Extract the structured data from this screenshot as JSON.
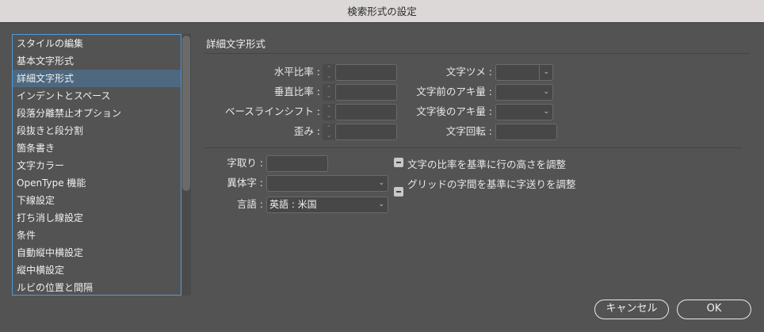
{
  "window": {
    "title": "検索形式の設定"
  },
  "sidebar": {
    "items": [
      "スタイルの編集",
      "基本文字形式",
      "詳細文字形式",
      "インデントとスペース",
      "段落分離禁止オプション",
      "段抜きと段分割",
      "箇条書き",
      "文字カラー",
      "OpenType 機能",
      "下線設定",
      "打ち消し線設定",
      "条件",
      "自動縦中横設定",
      "縦中横設定",
      "ルビの位置と間隔"
    ],
    "selected_index": 2
  },
  "panel": {
    "heading": "詳細文字形式",
    "horizontal_scale": {
      "label": "水平比率 :",
      "value": ""
    },
    "vertical_scale": {
      "label": "垂直比率 :",
      "value": ""
    },
    "baseline_shift": {
      "label": "ベースラインシフト :",
      "value": ""
    },
    "skew": {
      "label": "歪み :",
      "value": ""
    },
    "tsume": {
      "label": "文字ツメ :",
      "value": ""
    },
    "aki_before": {
      "label": "文字前のアキ量 :",
      "value": ""
    },
    "aki_after": {
      "label": "文字後のアキ量 :",
      "value": ""
    },
    "rotation": {
      "label": "文字回転 :",
      "value": ""
    },
    "mojidori": {
      "label": "字取り :",
      "value": ""
    },
    "itaiji": {
      "label": "異体字 :",
      "value": ""
    },
    "language": {
      "label": "言語 :",
      "value": "英語 : 米国"
    },
    "cb_scale_line_height": {
      "label": "文字の比率を基準に行の高さを調整",
      "state": "indeterminate"
    },
    "cb_grid_tracking": {
      "label": "グリッドの字間を基準に字送りを調整",
      "state": "indeterminate"
    }
  },
  "buttons": {
    "cancel": "キャンセル",
    "ok": "OK"
  }
}
